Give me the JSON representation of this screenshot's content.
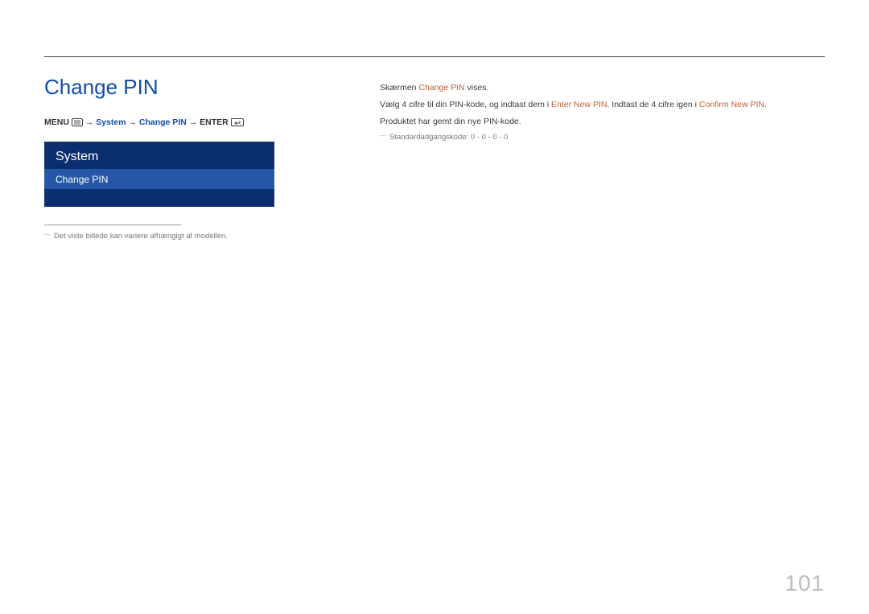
{
  "pageTitle": "Change PIN",
  "breadcrumb": {
    "menu": "MENU",
    "system": "System",
    "changePin": "Change PIN",
    "enter": "ENTER"
  },
  "panel": {
    "header": "System",
    "item": "Change PIN"
  },
  "leftFootnote": "Det viste billede kan variere afhængigt af modellen.",
  "right": {
    "line1_pre": "Skærmen ",
    "line1_hl": "Change PIN",
    "line1_post": " vises.",
    "line2_pre": "Vælg 4 cifre til din PIN-kode, og indtast dem i ",
    "line2_hl1": "Enter New PIN",
    "line2_mid": ". Indtast de 4 cifre igen i ",
    "line2_hl2": "Confirm New PIN",
    "line2_post": ".",
    "line3": "Produktet har gemt din nye PIN-kode.",
    "footnote": "Standardadgangskode: 0 - 0 - 0 - 0"
  },
  "pageNumber": "101"
}
